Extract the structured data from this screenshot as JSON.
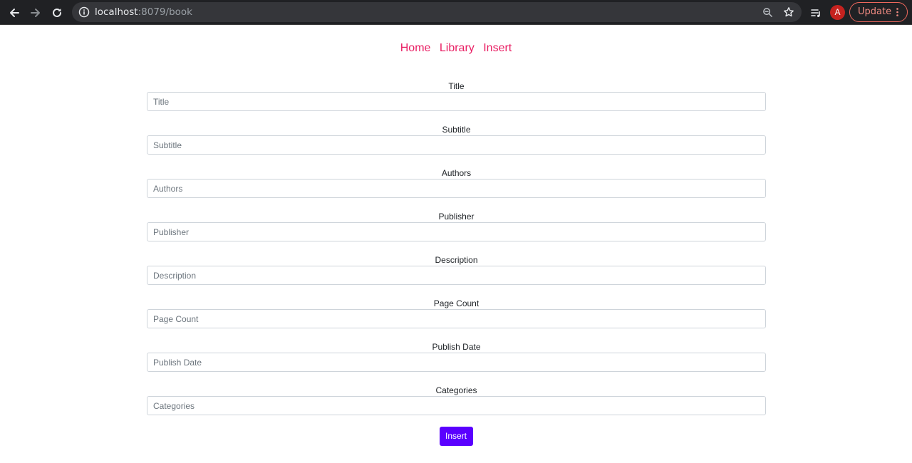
{
  "browser": {
    "url_host": "localhost",
    "url_path": ":8079/book",
    "profile_initial": "A",
    "update_label": "Update"
  },
  "nav": {
    "items": [
      {
        "label": "Home"
      },
      {
        "label": "Library"
      },
      {
        "label": "Insert"
      }
    ]
  },
  "form": {
    "fields": [
      {
        "label": "Title",
        "placeholder": "Title",
        "value": ""
      },
      {
        "label": "Subtitle",
        "placeholder": "Subtitle",
        "value": ""
      },
      {
        "label": "Authors",
        "placeholder": "Authors",
        "value": ""
      },
      {
        "label": "Publisher",
        "placeholder": "Publisher",
        "value": ""
      },
      {
        "label": "Description",
        "placeholder": "Description",
        "value": ""
      },
      {
        "label": "Page Count",
        "placeholder": "Page Count",
        "value": ""
      },
      {
        "label": "Publish Date",
        "placeholder": "Publish Date",
        "value": ""
      },
      {
        "label": "Categories",
        "placeholder": "Categories",
        "value": ""
      }
    ],
    "submit_label": "Insert"
  },
  "icons": {
    "back": "arrow-left-icon",
    "forward": "arrow-right-icon",
    "reload": "reload-icon",
    "site_info": "info-icon",
    "zoom": "zoom-icon",
    "bookmark": "star-icon",
    "media": "media-queue-icon",
    "menu": "kebab-menu-icon"
  },
  "colors": {
    "nav_link": "#e91e63",
    "submit_button": "#5a00ff",
    "chrome_bg": "#202124",
    "update_accent": "#ee675c"
  }
}
